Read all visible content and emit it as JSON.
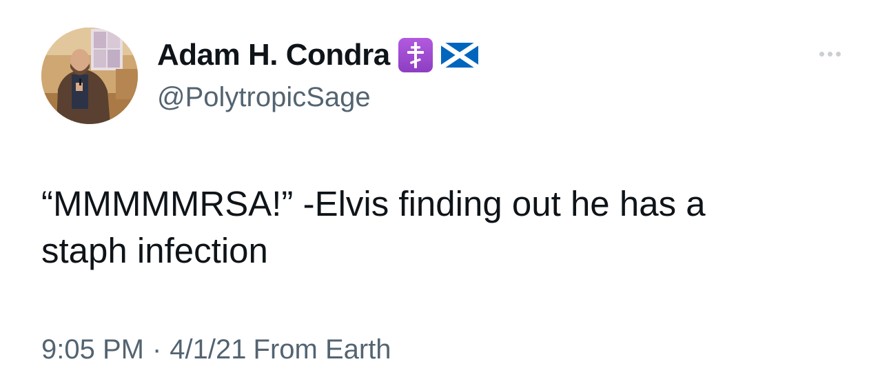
{
  "author": {
    "display_name": "Adam H. Condra",
    "handle": "@PolytropicSage",
    "badges": [
      "orthodox-cross-icon",
      "scotland-flag-icon"
    ]
  },
  "tweet": {
    "text": "“MMMMMRSA!” -Elvis finding out he has a\nstaph infection",
    "time": "9:05 PM",
    "separator": "·",
    "date": "4/1/21",
    "source": "From Earth"
  },
  "icons": {
    "more": "more-options-icon"
  },
  "colors": {
    "text_primary": "#0f1419",
    "text_secondary": "#536471",
    "badge_purple": "#9c4ad0",
    "flag_blue": "#0065bd"
  }
}
